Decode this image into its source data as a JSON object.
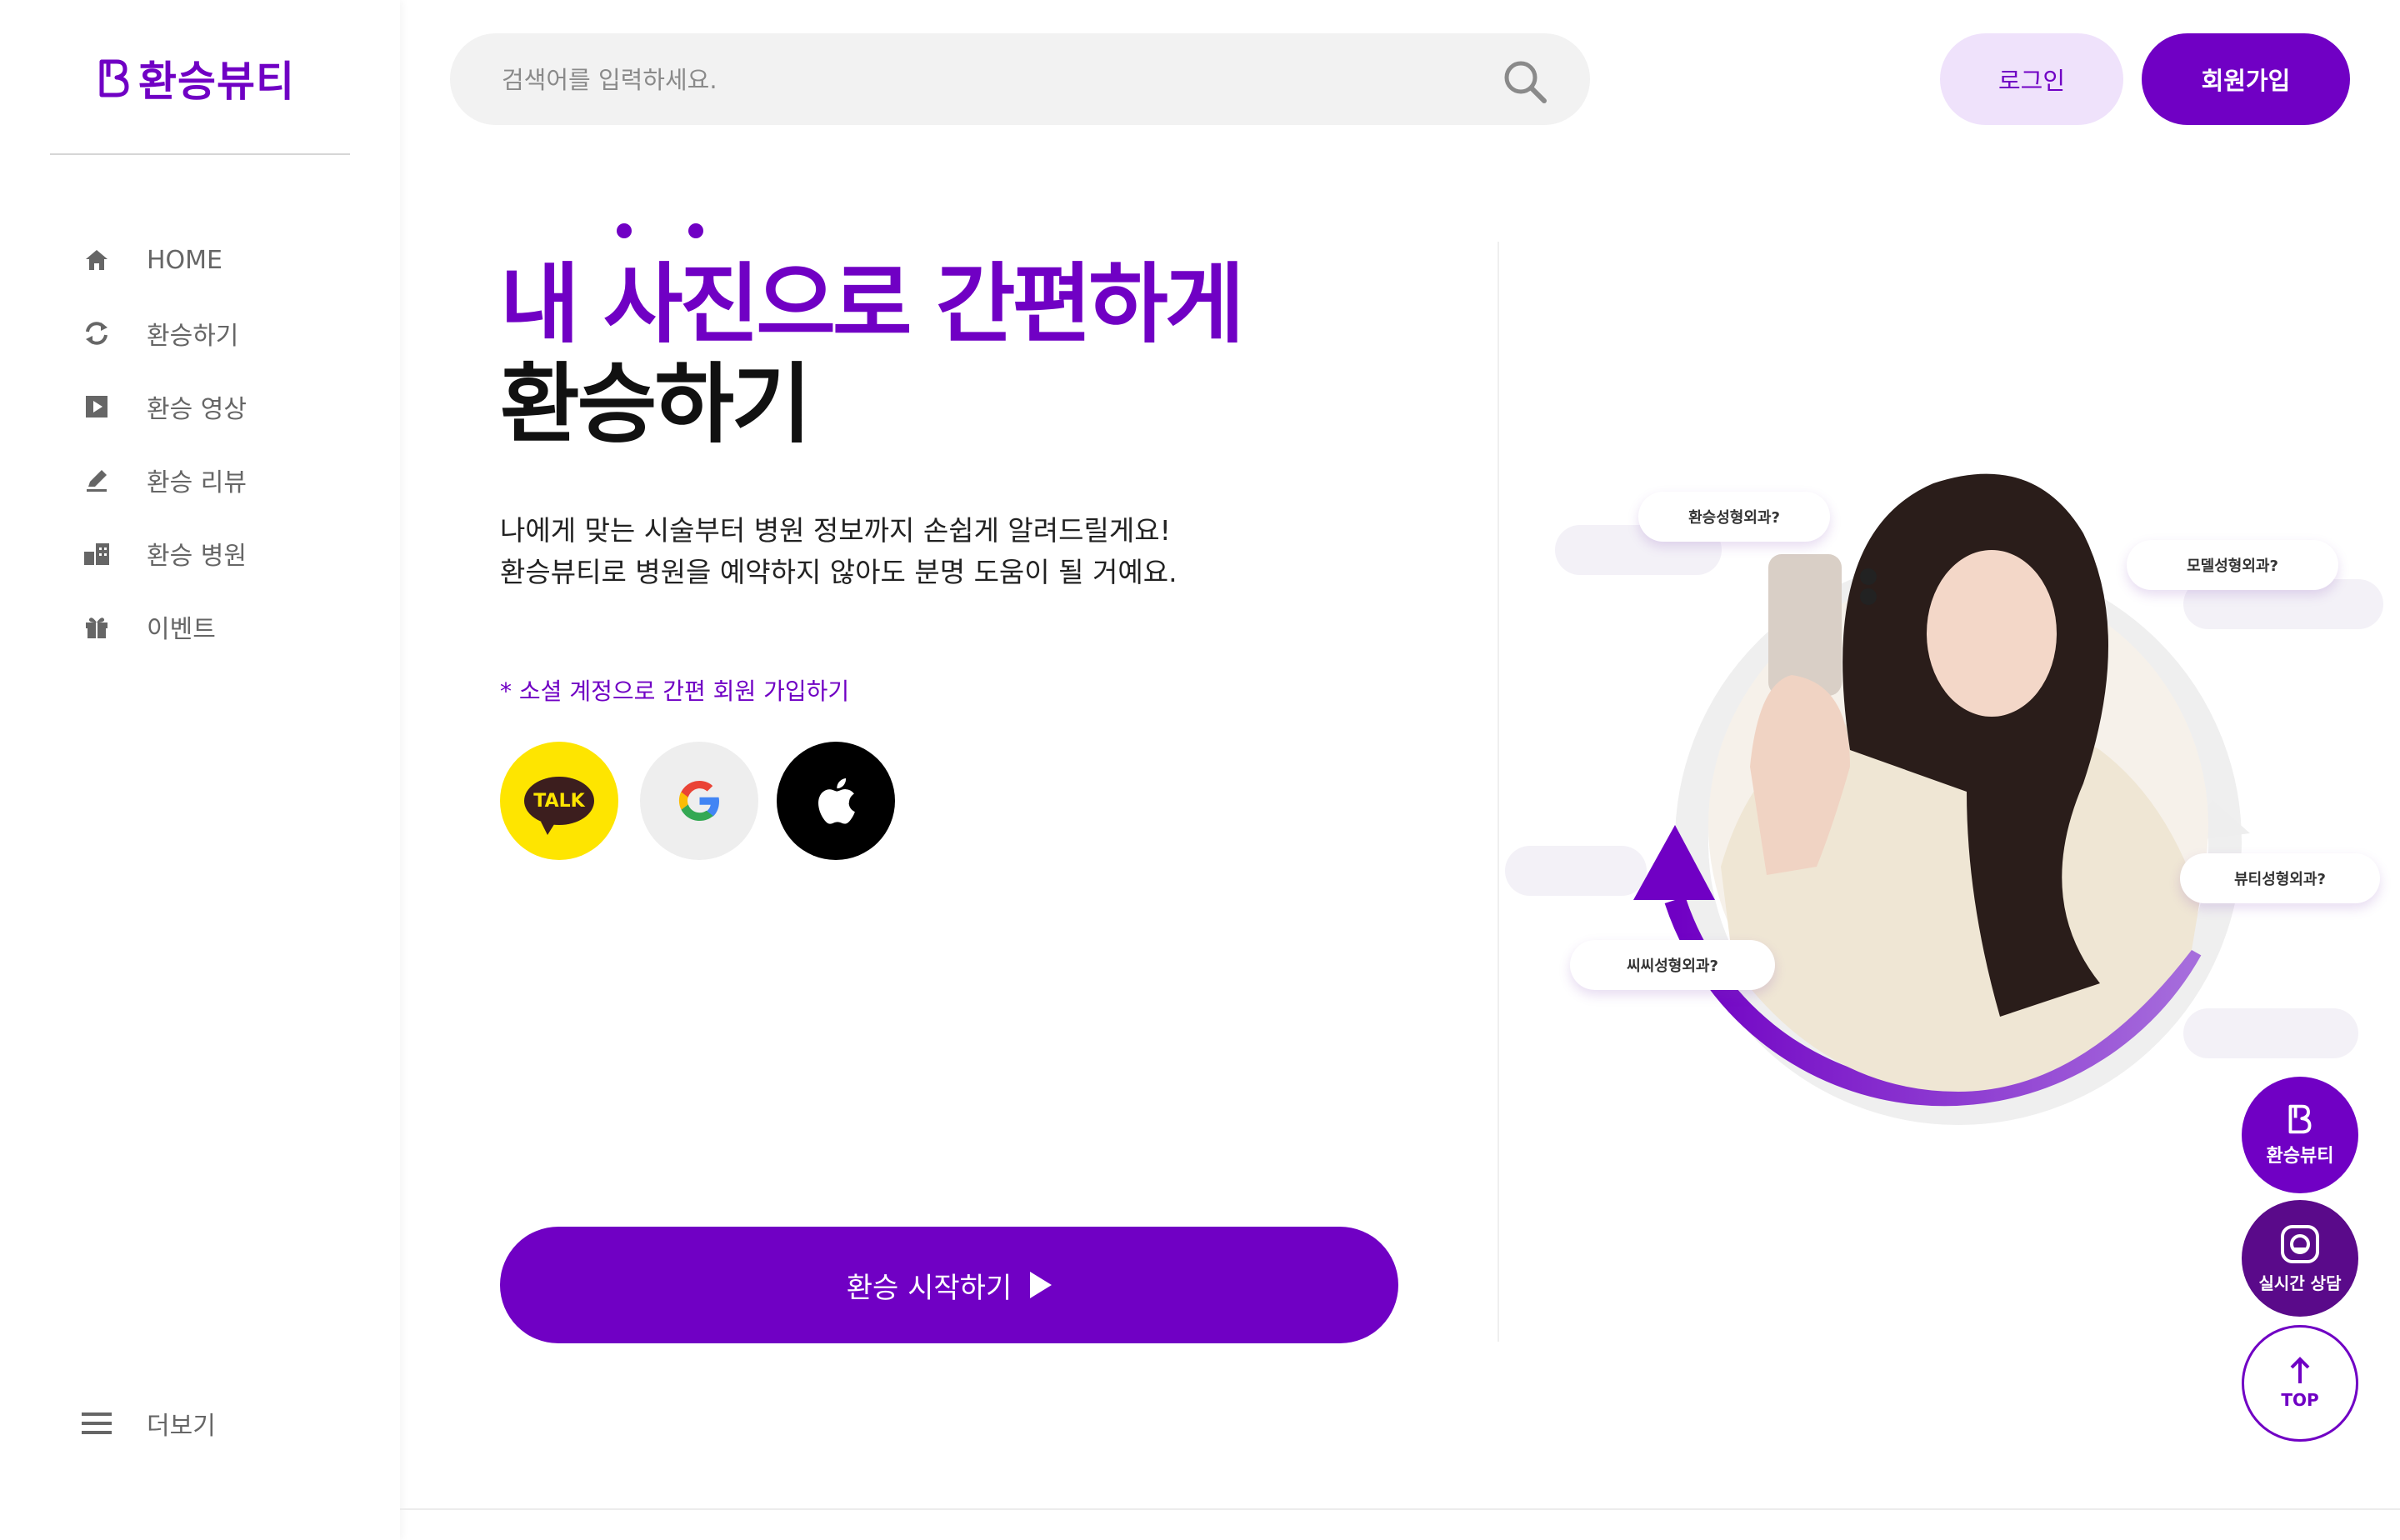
{
  "brand": {
    "logo_text": "환승뷰티"
  },
  "search": {
    "placeholder": "검색어를 입력하세요."
  },
  "header": {
    "login_label": "로그인",
    "signup_label": "회원가입"
  },
  "sidebar": {
    "items": [
      {
        "label": "HOME",
        "icon": "home-icon"
      },
      {
        "label": "환승하기",
        "icon": "refresh-icon"
      },
      {
        "label": "환승 영상",
        "icon": "play-icon"
      },
      {
        "label": "환승 리뷰",
        "icon": "pencil-icon"
      },
      {
        "label": "환승 병원",
        "icon": "building-icon"
      },
      {
        "label": "이벤트",
        "icon": "gift-icon"
      }
    ],
    "more_label": "더보기"
  },
  "hero": {
    "title_line1": "내 사진으로 간편하게",
    "title_line2": "환승하기",
    "desc_line1": "나에게 맞는 시술부터 병원 정보까지 손쉽게 알려드릴게요!",
    "desc_line2": "환승뷰티로 병원을 예약하지 않아도 분명 도움이 될 거예요.",
    "social_note": "* 소셜 계정으로 간편 회원 가입하기",
    "kakao_label": "TALK",
    "start_button": "환승 시작하기"
  },
  "illustration": {
    "bubbles": [
      "환승성형외과?",
      "모델성형외과?",
      "뷰티성형외과?",
      "씨씨성형외과?"
    ]
  },
  "floating": {
    "brand_label": "환승뷰티",
    "chat_label": "실시간 상담",
    "top_label": "TOP"
  },
  "colors": {
    "primary": "#7000c4",
    "primary_light": "#efe2fb",
    "kakao": "#fee500",
    "text_muted": "#666666",
    "search_bg": "#f2f2f2"
  }
}
